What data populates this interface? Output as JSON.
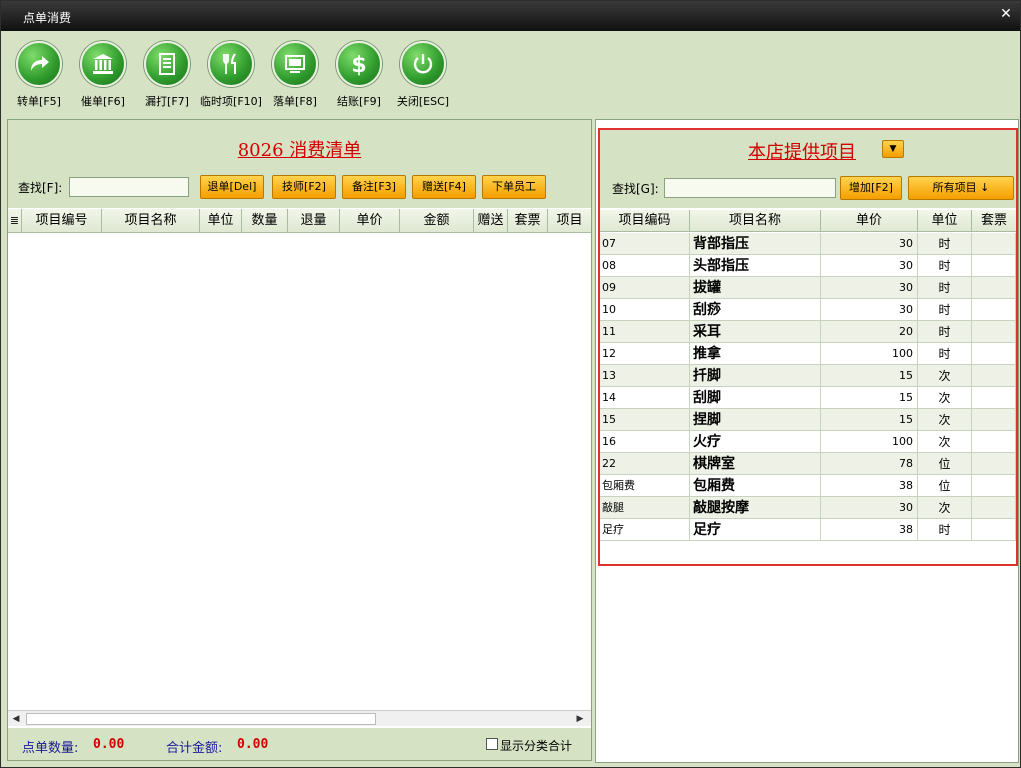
{
  "window": {
    "title": "点单消费",
    "close_glyph": "✕"
  },
  "toolbar": {
    "buttons": [
      {
        "label": "转单[F5]",
        "icon": "transfer-icon"
      },
      {
        "label": "催单[F6]",
        "icon": "bank-icon"
      },
      {
        "label": "漏打[F7]",
        "icon": "document-icon"
      },
      {
        "label": "临时项[F10]",
        "icon": "utensils-icon"
      },
      {
        "label": "落单[F8]",
        "icon": "screen-icon"
      },
      {
        "label": "结账[F9]",
        "icon": "dollar-icon"
      },
      {
        "label": "关闭[ESC]",
        "icon": "power-icon"
      }
    ]
  },
  "left_panel": {
    "title": "8026 消费清单",
    "search_label": "查找[F]:",
    "search_value": "",
    "buttons": {
      "refund": "退单[Del]",
      "technician": "技师[F2]",
      "note": "备注[F3]",
      "gift": "赠送[F4]",
      "staff": "下单员工"
    },
    "columns": [
      "项目编号",
      "项目名称",
      "单位",
      "数量",
      "退量",
      "单价",
      "金额",
      "赠送",
      "套票",
      "项目"
    ],
    "rows": [],
    "footer": {
      "order_qty_label": "点单数量:",
      "order_qty_value": "0.00",
      "total_label": "合计金额:",
      "total_value": "0.00",
      "show_category_label": "显示分类合计"
    }
  },
  "right_panel": {
    "title": "本店提供项目",
    "search_label": "查找[G]:",
    "search_value": "",
    "add_button": "增加[F2]",
    "all_items_button": "所有项目 ↓",
    "columns": [
      "项目编码",
      "项目名称",
      "单价",
      "单位",
      "套票"
    ],
    "rows": [
      {
        "code": "07",
        "name": "背部指压",
        "price": "30",
        "unit": "时",
        "pkg": ""
      },
      {
        "code": "08",
        "name": "头部指压",
        "price": "30",
        "unit": "时",
        "pkg": ""
      },
      {
        "code": "09",
        "name": "拔罐",
        "price": "30",
        "unit": "时",
        "pkg": ""
      },
      {
        "code": "10",
        "name": "刮痧",
        "price": "30",
        "unit": "时",
        "pkg": ""
      },
      {
        "code": "11",
        "name": "采耳",
        "price": "20",
        "unit": "时",
        "pkg": ""
      },
      {
        "code": "12",
        "name": "推拿",
        "price": "100",
        "unit": "时",
        "pkg": ""
      },
      {
        "code": "13",
        "name": "扦脚",
        "price": "15",
        "unit": "次",
        "pkg": ""
      },
      {
        "code": "14",
        "name": "刮脚",
        "price": "15",
        "unit": "次",
        "pkg": ""
      },
      {
        "code": "15",
        "name": "捏脚",
        "price": "15",
        "unit": "次",
        "pkg": ""
      },
      {
        "code": "16",
        "name": "火疗",
        "price": "100",
        "unit": "次",
        "pkg": ""
      },
      {
        "code": "22",
        "name": "棋牌室",
        "price": "78",
        "unit": "位",
        "pkg": ""
      },
      {
        "code": "包厢费",
        "name": "包厢费",
        "price": "38",
        "unit": "位",
        "pkg": ""
      },
      {
        "code": "敲腿",
        "name": "敲腿按摩",
        "price": "30",
        "unit": "次",
        "pkg": ""
      },
      {
        "code": "足疗",
        "name": "足疗",
        "price": "38",
        "unit": "时",
        "pkg": ""
      }
    ]
  }
}
